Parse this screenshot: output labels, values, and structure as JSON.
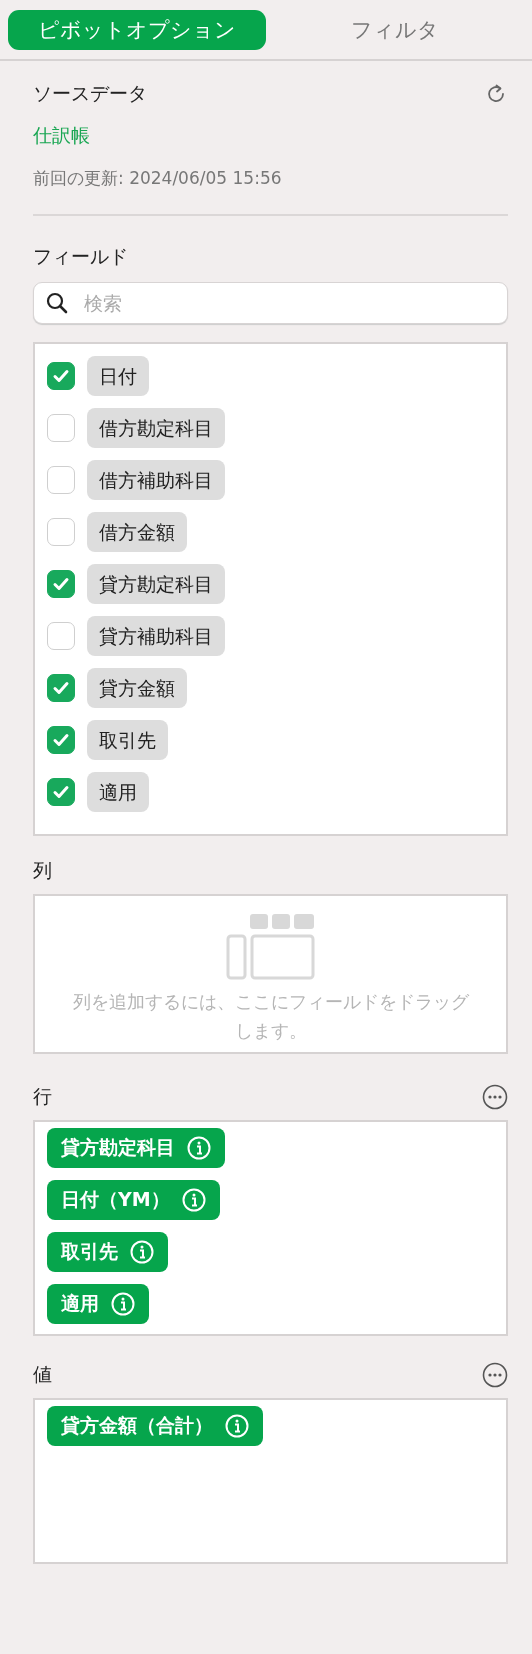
{
  "tabs": [
    {
      "label": "ピボットオプション",
      "selected": true
    },
    {
      "label": "フィルタ",
      "selected": false
    }
  ],
  "source": {
    "title": "ソースデータ",
    "name": "仕訳帳",
    "updated": "前回の更新: 2024/06/05 15:56"
  },
  "fields": {
    "title": "フィールド",
    "search": {
      "placeholder": "検索"
    },
    "items": [
      {
        "label": "日付",
        "checked": true
      },
      {
        "label": "借方勘定科目",
        "checked": false
      },
      {
        "label": "借方補助科目",
        "checked": false
      },
      {
        "label": "借方金額",
        "checked": false
      },
      {
        "label": "貸方勘定科目",
        "checked": true
      },
      {
        "label": "貸方補助科目",
        "checked": false
      },
      {
        "label": "貸方金額",
        "checked": true
      },
      {
        "label": "取引先",
        "checked": true
      },
      {
        "label": "適用",
        "checked": true
      }
    ]
  },
  "columns": {
    "title": "列",
    "placeholder": "列を追加するには、ここにフィールドをドラッグします。"
  },
  "rows": {
    "title": "行",
    "items": [
      {
        "label": "貸方勘定科目"
      },
      {
        "label": "日付（YM）"
      },
      {
        "label": "取引先"
      },
      {
        "label": "適用"
      }
    ]
  },
  "values": {
    "title": "値",
    "items": [
      {
        "label": "貸方金額（合計）"
      }
    ]
  }
}
